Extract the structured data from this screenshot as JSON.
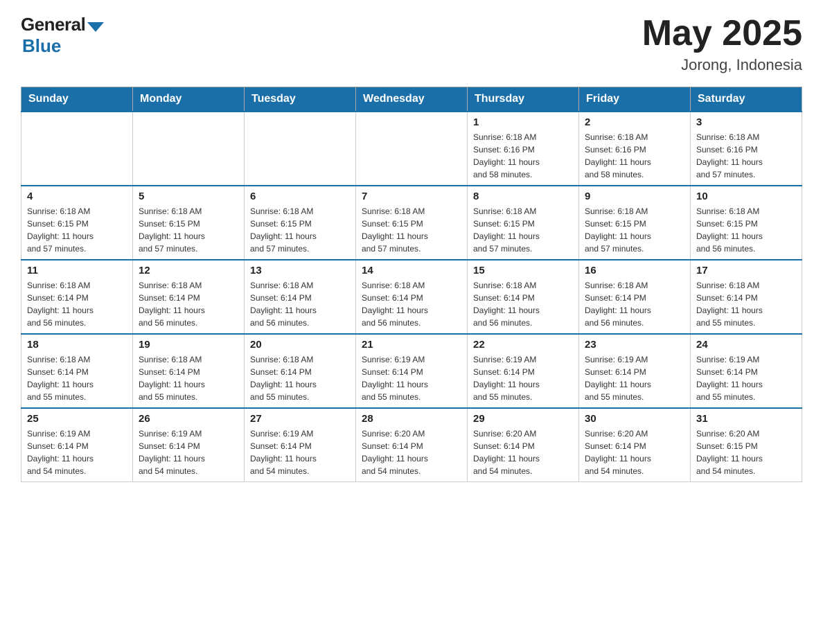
{
  "header": {
    "logo_general": "General",
    "logo_blue": "Blue",
    "month_year": "May 2025",
    "location": "Jorong, Indonesia"
  },
  "days_of_week": [
    "Sunday",
    "Monday",
    "Tuesday",
    "Wednesday",
    "Thursday",
    "Friday",
    "Saturday"
  ],
  "weeks": [
    [
      {
        "day": "",
        "info": ""
      },
      {
        "day": "",
        "info": ""
      },
      {
        "day": "",
        "info": ""
      },
      {
        "day": "",
        "info": ""
      },
      {
        "day": "1",
        "info": "Sunrise: 6:18 AM\nSunset: 6:16 PM\nDaylight: 11 hours\nand 58 minutes."
      },
      {
        "day": "2",
        "info": "Sunrise: 6:18 AM\nSunset: 6:16 PM\nDaylight: 11 hours\nand 58 minutes."
      },
      {
        "day": "3",
        "info": "Sunrise: 6:18 AM\nSunset: 6:16 PM\nDaylight: 11 hours\nand 57 minutes."
      }
    ],
    [
      {
        "day": "4",
        "info": "Sunrise: 6:18 AM\nSunset: 6:15 PM\nDaylight: 11 hours\nand 57 minutes."
      },
      {
        "day": "5",
        "info": "Sunrise: 6:18 AM\nSunset: 6:15 PM\nDaylight: 11 hours\nand 57 minutes."
      },
      {
        "day": "6",
        "info": "Sunrise: 6:18 AM\nSunset: 6:15 PM\nDaylight: 11 hours\nand 57 minutes."
      },
      {
        "day": "7",
        "info": "Sunrise: 6:18 AM\nSunset: 6:15 PM\nDaylight: 11 hours\nand 57 minutes."
      },
      {
        "day": "8",
        "info": "Sunrise: 6:18 AM\nSunset: 6:15 PM\nDaylight: 11 hours\nand 57 minutes."
      },
      {
        "day": "9",
        "info": "Sunrise: 6:18 AM\nSunset: 6:15 PM\nDaylight: 11 hours\nand 57 minutes."
      },
      {
        "day": "10",
        "info": "Sunrise: 6:18 AM\nSunset: 6:15 PM\nDaylight: 11 hours\nand 56 minutes."
      }
    ],
    [
      {
        "day": "11",
        "info": "Sunrise: 6:18 AM\nSunset: 6:14 PM\nDaylight: 11 hours\nand 56 minutes."
      },
      {
        "day": "12",
        "info": "Sunrise: 6:18 AM\nSunset: 6:14 PM\nDaylight: 11 hours\nand 56 minutes."
      },
      {
        "day": "13",
        "info": "Sunrise: 6:18 AM\nSunset: 6:14 PM\nDaylight: 11 hours\nand 56 minutes."
      },
      {
        "day": "14",
        "info": "Sunrise: 6:18 AM\nSunset: 6:14 PM\nDaylight: 11 hours\nand 56 minutes."
      },
      {
        "day": "15",
        "info": "Sunrise: 6:18 AM\nSunset: 6:14 PM\nDaylight: 11 hours\nand 56 minutes."
      },
      {
        "day": "16",
        "info": "Sunrise: 6:18 AM\nSunset: 6:14 PM\nDaylight: 11 hours\nand 56 minutes."
      },
      {
        "day": "17",
        "info": "Sunrise: 6:18 AM\nSunset: 6:14 PM\nDaylight: 11 hours\nand 55 minutes."
      }
    ],
    [
      {
        "day": "18",
        "info": "Sunrise: 6:18 AM\nSunset: 6:14 PM\nDaylight: 11 hours\nand 55 minutes."
      },
      {
        "day": "19",
        "info": "Sunrise: 6:18 AM\nSunset: 6:14 PM\nDaylight: 11 hours\nand 55 minutes."
      },
      {
        "day": "20",
        "info": "Sunrise: 6:18 AM\nSunset: 6:14 PM\nDaylight: 11 hours\nand 55 minutes."
      },
      {
        "day": "21",
        "info": "Sunrise: 6:19 AM\nSunset: 6:14 PM\nDaylight: 11 hours\nand 55 minutes."
      },
      {
        "day": "22",
        "info": "Sunrise: 6:19 AM\nSunset: 6:14 PM\nDaylight: 11 hours\nand 55 minutes."
      },
      {
        "day": "23",
        "info": "Sunrise: 6:19 AM\nSunset: 6:14 PM\nDaylight: 11 hours\nand 55 minutes."
      },
      {
        "day": "24",
        "info": "Sunrise: 6:19 AM\nSunset: 6:14 PM\nDaylight: 11 hours\nand 55 minutes."
      }
    ],
    [
      {
        "day": "25",
        "info": "Sunrise: 6:19 AM\nSunset: 6:14 PM\nDaylight: 11 hours\nand 54 minutes."
      },
      {
        "day": "26",
        "info": "Sunrise: 6:19 AM\nSunset: 6:14 PM\nDaylight: 11 hours\nand 54 minutes."
      },
      {
        "day": "27",
        "info": "Sunrise: 6:19 AM\nSunset: 6:14 PM\nDaylight: 11 hours\nand 54 minutes."
      },
      {
        "day": "28",
        "info": "Sunrise: 6:20 AM\nSunset: 6:14 PM\nDaylight: 11 hours\nand 54 minutes."
      },
      {
        "day": "29",
        "info": "Sunrise: 6:20 AM\nSunset: 6:14 PM\nDaylight: 11 hours\nand 54 minutes."
      },
      {
        "day": "30",
        "info": "Sunrise: 6:20 AM\nSunset: 6:14 PM\nDaylight: 11 hours\nand 54 minutes."
      },
      {
        "day": "31",
        "info": "Sunrise: 6:20 AM\nSunset: 6:15 PM\nDaylight: 11 hours\nand 54 minutes."
      }
    ]
  ]
}
